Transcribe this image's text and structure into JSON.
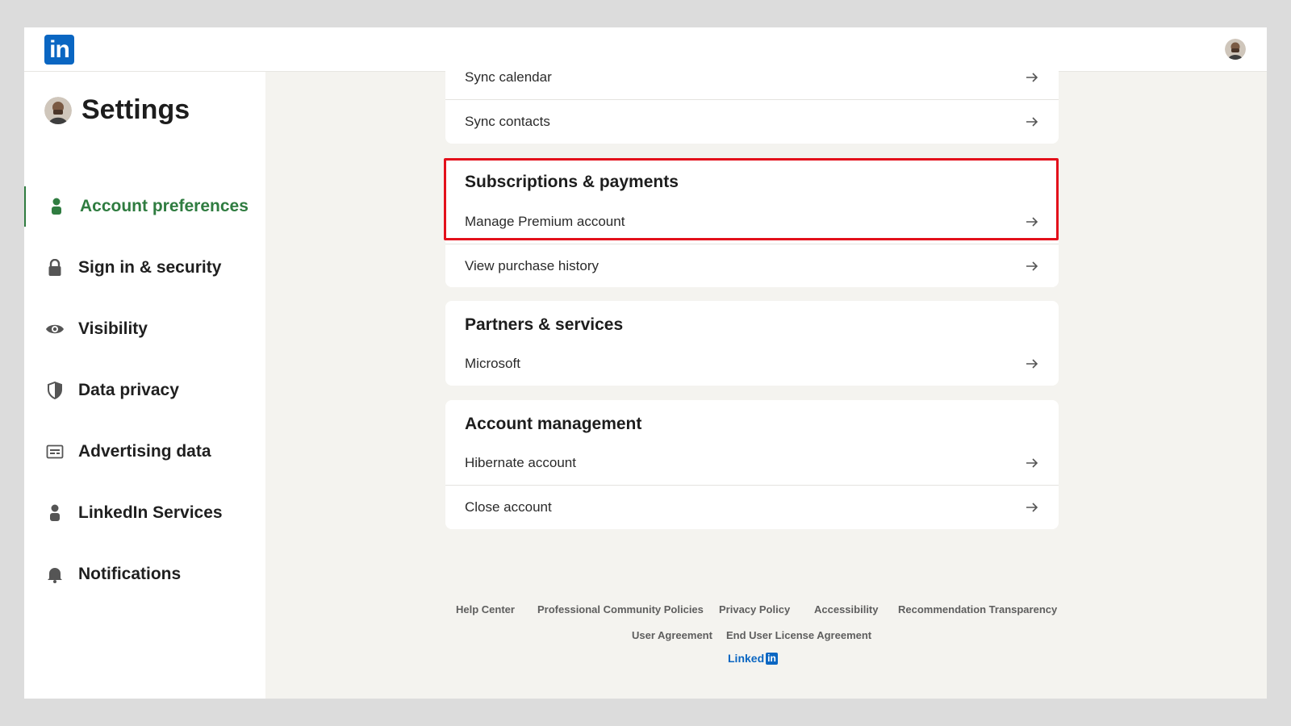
{
  "brand": {
    "logo_text": "in",
    "color": "#0a66c2"
  },
  "sidebar": {
    "title": "Settings",
    "items": [
      {
        "label": "Account preferences",
        "icon": "person-icon",
        "active": true
      },
      {
        "label": "Sign in & security",
        "icon": "lock-icon",
        "active": false
      },
      {
        "label": "Visibility",
        "icon": "eye-icon",
        "active": false
      },
      {
        "label": "Data privacy",
        "icon": "shield-icon",
        "active": false
      },
      {
        "label": "Advertising data",
        "icon": "ad-icon",
        "active": false
      },
      {
        "label": "LinkedIn Services",
        "icon": "person-icon",
        "active": false
      },
      {
        "label": "Notifications",
        "icon": "bell-icon",
        "active": false
      }
    ],
    "active_color": "#2f7c40"
  },
  "main": {
    "sync_card": {
      "rows": [
        "Sync calendar",
        "Sync contacts"
      ]
    },
    "subscriptions_card": {
      "title": "Subscriptions & payments",
      "rows": [
        "Manage Premium account",
        "View purchase history"
      ]
    },
    "partners_card": {
      "title": "Partners & services",
      "rows": [
        "Microsoft"
      ]
    },
    "account_management_card": {
      "title": "Account management",
      "rows": [
        "Hibernate account",
        "Close account"
      ]
    },
    "highlight_color": "#e3101b"
  },
  "footer": {
    "links_row1": [
      "Help Center",
      "Professional Community Policies",
      "Privacy Policy",
      "Accessibility",
      "Recommendation Transparency"
    ],
    "links_row2": [
      "User Agreement",
      "End User License Agreement"
    ],
    "logo_word": "Linked",
    "logo_in": "in"
  }
}
